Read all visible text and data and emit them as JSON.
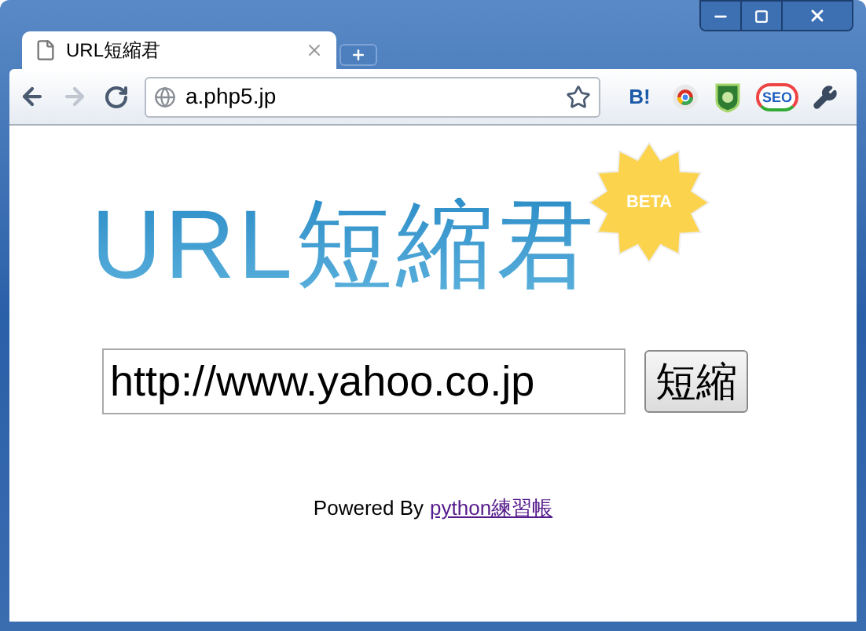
{
  "tab": {
    "title": "URL短縮君",
    "selected": true
  },
  "navigation": {
    "forward_disabled": true
  },
  "address_bar": {
    "url": "a.php5.jp"
  },
  "extensions": [
    {
      "kind": "text",
      "label": "B!"
    },
    {
      "kind": "chrome"
    },
    {
      "kind": "shield"
    },
    {
      "kind": "text-badge",
      "label": "SEO"
    }
  ],
  "logo": {
    "title": "URL短縮君",
    "badge": "BETA"
  },
  "form": {
    "url_value": "http://www.yahoo.co.jp",
    "submit": "短縮"
  },
  "footer": {
    "prefix": "Powered By",
    "link": "python練習帳"
  }
}
